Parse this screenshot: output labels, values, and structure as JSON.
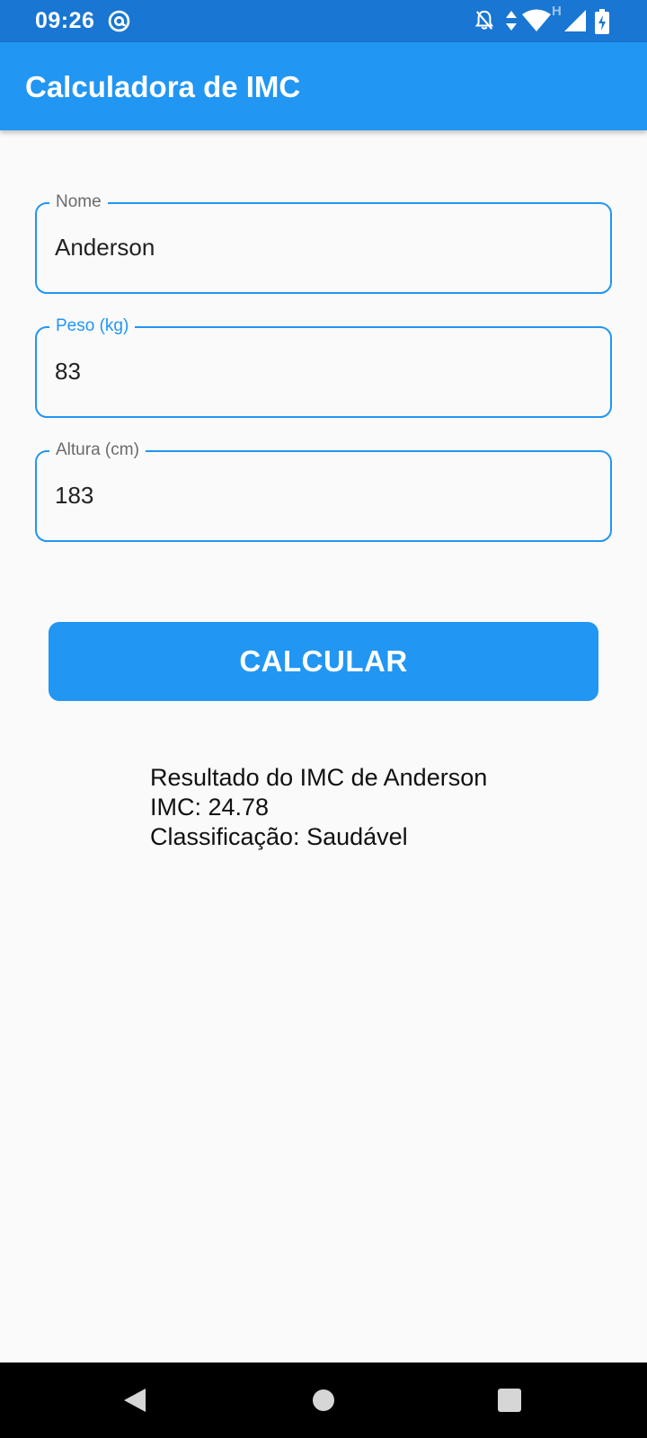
{
  "status_bar": {
    "time": "09:26",
    "icons": [
      "at-sign-icon",
      "notifications-off-icon",
      "data-arrows-icon",
      "wifi-icon",
      "signal-icon",
      "battery-charging-icon"
    ],
    "network_badge": "H"
  },
  "app_bar": {
    "title": "Calculadora de IMC",
    "color": "#2196f3"
  },
  "form": {
    "nome": {
      "label": "Nome",
      "value": "Anderson"
    },
    "peso": {
      "label": "Peso (kg)",
      "value": "83"
    },
    "altura": {
      "label": "Altura (cm)",
      "value": "183"
    }
  },
  "button": {
    "label": "CALCULAR"
  },
  "result": {
    "line1": "Resultado do IMC de Anderson",
    "line2": "IMC: 24.78",
    "line3": "Classificação: Saudável"
  },
  "nav_bar": {
    "icons": [
      "back-icon",
      "home-icon",
      "recents-icon"
    ]
  },
  "colors": {
    "primary": "#2196f3",
    "status_bar": "#1976d2",
    "background": "#fafafa"
  }
}
